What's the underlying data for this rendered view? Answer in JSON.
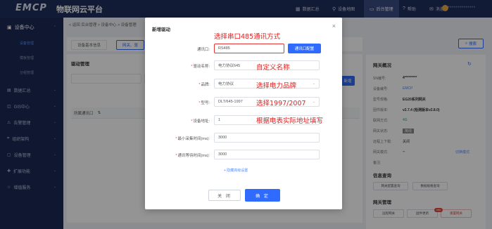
{
  "header": {
    "logo": "EMCP",
    "platform": "物联网云平台",
    "nav": [
      {
        "label": "数据汇总",
        "icon": "dashboard-icon"
      },
      {
        "label": "设备地图",
        "icon": "location-icon"
      },
      {
        "label": "后台管理",
        "icon": "monitor-icon"
      },
      {
        "label": "帮助",
        "icon": "help-icon"
      },
      {
        "label": "消息",
        "icon": "message-icon"
      }
    ],
    "username": "3**************"
  },
  "sidebar": {
    "title": "设备中心",
    "subitems": [
      "设备管理",
      "模板管理",
      "分组管理"
    ],
    "items": [
      "数据汇总",
      "GIS中心",
      "告警管理",
      "组织架构",
      "设备管理",
      "扩展功能",
      "增值服务"
    ]
  },
  "main": {
    "breadcrumb": "< 返回  后台管理 > 设备中心 > 设备管理",
    "tabs": [
      "设备基本信息",
      "网关、驱"
    ],
    "panel_title": "驱动管理",
    "search_button": "搜索",
    "add_button": "新增",
    "table_header": "所属通讯口"
  },
  "overview": {
    "title": "网关概况",
    "rows": [
      {
        "k": "SN编号:",
        "v": "4*********"
      },
      {
        "k": "设备编号:",
        "v": "EMCP"
      },
      {
        "k": "型号规格:",
        "v": "EG20系列网关"
      },
      {
        "k": "固件版本:",
        "v": "v2.7.4 (检测版本v2.8.0)"
      },
      {
        "k": "联网方式:",
        "v": "4G"
      },
      {
        "k": "网关状态:",
        "v": "离线"
      },
      {
        "k": "远程上下载:",
        "v": "关闭"
      },
      {
        "k": "网关模式:",
        "v": "--"
      },
      {
        "k": "备注:",
        "v": ""
      }
    ],
    "mode_link": "切换模式",
    "info_title": "信息查询",
    "query_buttons": [
      "网关配置查询",
      "数据规格查询"
    ],
    "manage_title": "网关管理",
    "manage_buttons": [
      "远程网关",
      "固件更新",
      "重置网关"
    ],
    "badge": "new"
  },
  "dialog": {
    "title": "新增驱动",
    "fields": [
      {
        "label": "通讯口:",
        "value": "RS485",
        "required": false,
        "select": false
      },
      {
        "label": "驱动名称:",
        "value": "电力协议645",
        "required": true,
        "select": false
      },
      {
        "label": "品牌:",
        "value": "电力协议",
        "required": true,
        "select": true
      },
      {
        "label": "型号:",
        "value": "DLT/645-1997",
        "required": true,
        "select": true
      },
      {
        "label": "设备地址:",
        "value": "1",
        "required": true,
        "select": false
      },
      {
        "label": "最小采集时间(ms):",
        "value": "3000",
        "required": true,
        "select": false
      },
      {
        "label": "通讯等待时间(ms):",
        "value": "3000",
        "required": true,
        "select": false
      }
    ],
    "port_config_button": "通讯口配置",
    "advanced": "+ 隐藏高级设置",
    "cancel": "关 闭",
    "confirm": "确 定"
  },
  "annotations": [
    "选择串口485通讯方式",
    "自定义名称",
    "选择电力品牌",
    "选择1997/2007",
    "根据电表实际地址填写"
  ],
  "colors": {
    "header": "#20305e",
    "sidebar": "#1c2a55",
    "primary": "#2f6bff",
    "annotation": "#e02020"
  }
}
